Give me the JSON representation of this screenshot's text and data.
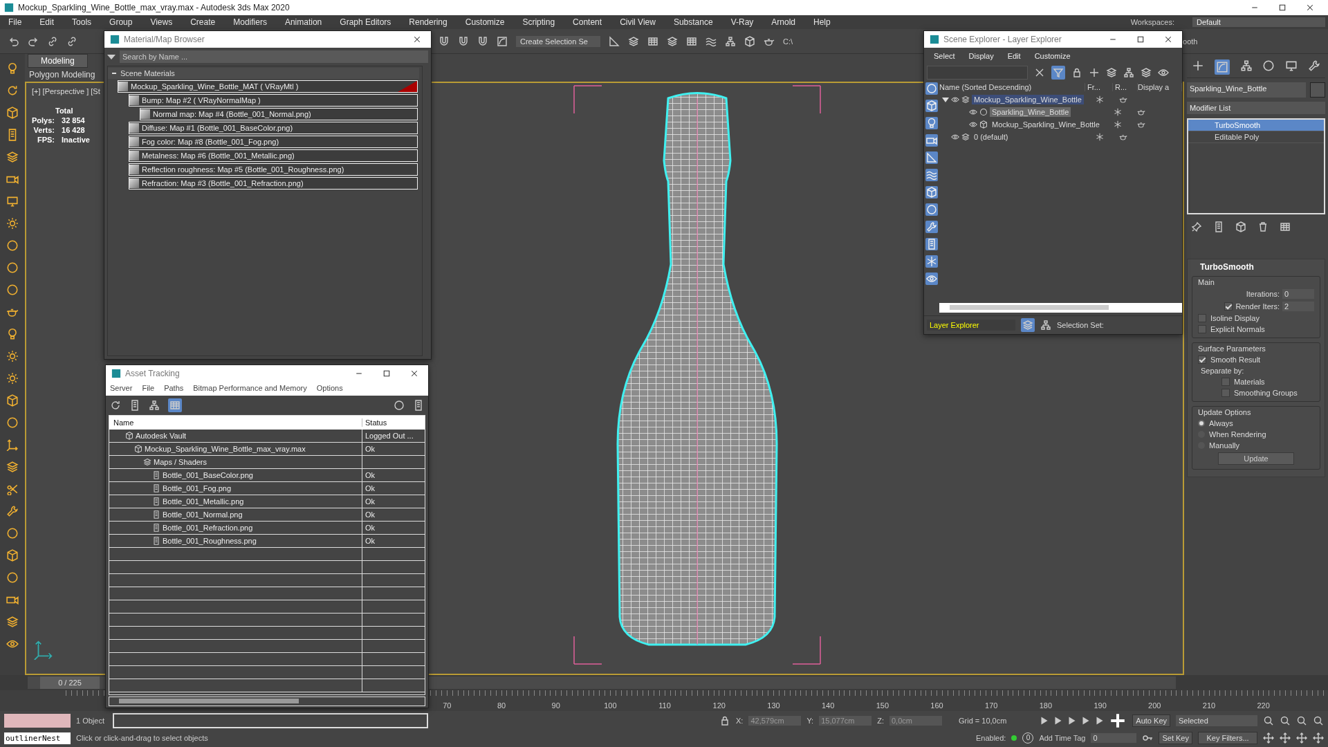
{
  "window": {
    "title": "Mockup_Sparkling_Wine_Bottle_max_vray.max - Autodesk 3ds Max 2020",
    "workspaces_label": "Workspaces:",
    "workspace": "Default"
  },
  "menu": [
    "File",
    "Edit",
    "Tools",
    "Group",
    "Views",
    "Create",
    "Modifiers",
    "Animation",
    "Graph Editors",
    "Rendering",
    "Customize",
    "Scripting",
    "Content",
    "Civil View",
    "Substance",
    "V-Ray",
    "Arnold",
    "Help"
  ],
  "toolbar": {
    "selection_set": "Create Selection Se",
    "path": "C:\\",
    "partial_text": "ooth"
  },
  "ribbon": {
    "tabs": [
      {
        "label": "Modeling",
        "selected": true
      }
    ],
    "subtab": "Polygon Modeling"
  },
  "viewport": {
    "label": "[+] [Perspective ] [St",
    "stats_heading": "Total",
    "stats": [
      {
        "label": "Polys:",
        "value": "32 854"
      },
      {
        "label": "Verts:",
        "value": "16 428"
      },
      {
        "label": "FPS:",
        "value": "Inactive"
      }
    ]
  },
  "material_browser": {
    "title": "Material/Map Browser",
    "search_placeholder": "Search by Name ...",
    "group": {
      "label": "Scene Materials",
      "expanded": true
    },
    "tree": [
      {
        "label": "Mockup_Sparkling_Wine_Bottle_MAT  ( VRayMtl )",
        "children": [
          {
            "label": "Bump: Map #2  ( VRayNormalMap )",
            "children": [
              {
                "label": "Normal map: Map #4 (Bottle_001_Normal.png)"
              }
            ]
          },
          {
            "label": "Diffuse: Map #1 (Bottle_001_BaseColor.png)"
          },
          {
            "label": "Fog color: Map #8 (Bottle_001_Fog.png)"
          },
          {
            "label": "Metalness: Map #6 (Bottle_001_Metallic.png)"
          },
          {
            "label": "Reflection roughness: Map #5 (Bottle_001_Roughness.png)"
          },
          {
            "label": "Refraction: Map #3 (Bottle_001_Refraction.png)"
          }
        ]
      }
    ]
  },
  "asset_tracking": {
    "title": "Asset Tracking",
    "menu": [
      "Server",
      "File",
      "Paths",
      "Bitmap Performance and Memory",
      "Options"
    ],
    "columns": [
      "Name",
      "Status"
    ],
    "tree": [
      {
        "name": "Autodesk Vault",
        "kind": "vault",
        "status": "Logged Out ...",
        "children": [
          {
            "name": "Mockup_Sparkling_Wine_Bottle_max_vray.max",
            "kind": "scene",
            "status": "Ok",
            "children": [
              {
                "name": "Maps / Shaders",
                "kind": "folder",
                "children": [
                  {
                    "name": "Bottle_001_BaseColor.png",
                    "kind": "png",
                    "status": "Ok"
                  },
                  {
                    "name": "Bottle_001_Fog.png",
                    "kind": "png",
                    "status": "Ok"
                  },
                  {
                    "name": "Bottle_001_Metallic.png",
                    "kind": "png",
                    "status": "Ok"
                  },
                  {
                    "name": "Bottle_001_Normal.png",
                    "kind": "png",
                    "status": "Ok"
                  },
                  {
                    "name": "Bottle_001_Refraction.png",
                    "kind": "png",
                    "status": "Ok"
                  },
                  {
                    "name": "Bottle_001_Roughness.png",
                    "kind": "png",
                    "status": "Ok"
                  }
                ]
              }
            ]
          }
        ]
      }
    ]
  },
  "scene_explorer": {
    "title": "Scene Explorer - Layer Explorer",
    "menu": [
      "Select",
      "Display",
      "Edit",
      "Customize"
    ],
    "columns": [
      "Name (Sorted Descending)",
      "Fr...",
      "R...",
      "Display a"
    ],
    "tree": [
      {
        "name": "Mockup_Sparkling_Wine_Bottle",
        "kind": "layer",
        "expanded": true,
        "selected": true,
        "children": [
          {
            "name": "Sparkling_Wine_Bottle",
            "kind": "object",
            "selected": true
          },
          {
            "name": "Mockup_Sparkling_Wine_Bottle",
            "kind": "group",
            "selected": false
          }
        ]
      },
      {
        "name": "0 (default)",
        "kind": "layer",
        "selected": false
      }
    ],
    "explorer_mode": "Layer Explorer",
    "selection_set_label": "Selection Set:"
  },
  "command_panel": {
    "object_name": "Sparkling_Wine_Bottle",
    "modifier_list": "Modifier List",
    "stack": [
      {
        "name": "TurboSmooth",
        "selected": true
      },
      {
        "name": "Editable Poly",
        "selected": false
      }
    ],
    "rollout": "TurboSmooth",
    "main_label": "Main",
    "iterations_label": "Iterations:",
    "iterations": "0",
    "render_iters": {
      "label": "Render Iters:",
      "checked": true,
      "value": "2"
    },
    "main_options": [
      {
        "label": "Isoline Display",
        "checked": false
      },
      {
        "label": "Explicit Normals",
        "checked": false
      }
    ],
    "surface_label": "Surface Parameters",
    "smooth_result": {
      "label": "Smooth Result",
      "checked": true
    },
    "separate_label": "Separate by:",
    "separate": [
      {
        "label": "Materials",
        "checked": false
      },
      {
        "label": "Smoothing Groups",
        "checked": false
      }
    ],
    "update_label": "Update Options",
    "update_options": [
      {
        "label": "Always",
        "selected": true
      },
      {
        "label": "When Rendering",
        "selected": false
      },
      {
        "label": "Manually",
        "selected": false
      }
    ],
    "update_button": "Update"
  },
  "timeline": {
    "frame": "0 / 225",
    "ticks": [
      "70",
      "80",
      "90",
      "100",
      "110",
      "120",
      "130",
      "140",
      "150",
      "160",
      "170",
      "180",
      "190",
      "200",
      "210",
      "220"
    ]
  },
  "status_bar": {
    "objects": "1 Object",
    "script_field": "outlinerNest",
    "prompt": "Click or click-and-drag to select objects",
    "x_label": "X:",
    "x": "42,579cm",
    "y_label": "Y:",
    "y": "15,077cm",
    "z_label": "Z:",
    "z": "0,0cm",
    "grid": "Grid = 10,0cm",
    "enabled_label": "Enabled:",
    "tag_count": "0",
    "add_time_tag": "Add Time Tag",
    "auto_key": "Auto Key",
    "key_mode": "Selected",
    "set_key": "Set Key",
    "key_filters": "Key Filters...",
    "current_frame": "0"
  }
}
